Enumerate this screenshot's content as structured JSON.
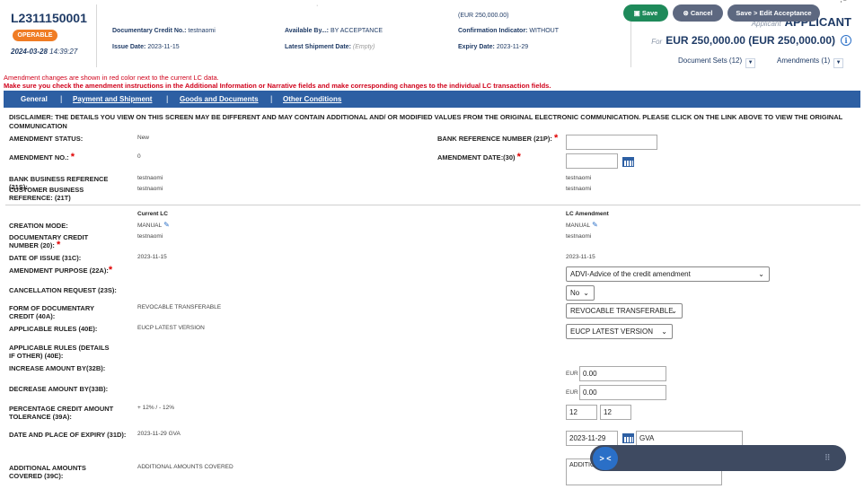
{
  "header": {
    "lc_ref": "L2311150001",
    "status_badge": "OPERABLE",
    "date": "2024-03-28",
    "time": "14:39:27",
    "documentary_credit_no_label": "Documentary Credit No.:",
    "documentary_credit_no": "testnaomi",
    "issue_date_label": "Issue Date:",
    "issue_date": "2023-11-15",
    "available_by_label": "Available By...:",
    "available_by": "BY ACCEPTANCE",
    "latest_shipment_label": "Latest Shipment Date:",
    "latest_shipment": "(Empty)",
    "amount_small": "(EUR 250,000.00)",
    "confirmation_label": "Confirmation Indicator:",
    "confirmation": "WITHOUT",
    "expiry_label": "Expiry Date:",
    "expiry": "2023-11-29",
    "applicant_label": "Applicant",
    "applicant": "APPLICANT",
    "for_label": "For",
    "amount": "EUR 250,000.00 (EUR 250,000.00)",
    "document_sets": "Document Sets (12)",
    "amendments": "Amendments (1)",
    "dot": "·",
    "corner_glyphs": "′ ‾"
  },
  "warnings": {
    "line1": "Amendment changes are shown in red color next to the current LC data.",
    "line2": "Make sure you check the amendment instructions in the Additional Information or Narrative fields and make corresponding changes to the individual LC transaction fields."
  },
  "tabs": [
    "General",
    "Payment and Shipment",
    "Goods and Documents",
    "Other Conditions"
  ],
  "tab_separator": "|",
  "form": {
    "disclaimer": "DISCLAIMER: THE DETAILS YOU VIEW ON THIS SCREEN MAY BE DIFFERENT AND MAY CONTAIN ADDITIONAL AND/ OR MODIFIED VALUES FROM THE ORIGINAL ELECTRONIC COMMUNICATION. PLEASE CLICK ON THE LINK ABOVE TO VIEW THE ORIGINAL COMMUNICATION",
    "amendment_status_label": "AMENDMENT STATUS:",
    "amendment_status": "New",
    "bank_ref_label": "BANK REFERENCE NUMBER (21P):",
    "amendment_no_label": "AMENDMENT NO.:",
    "amendment_no": "0",
    "amendment_date_label": "AMENDMENT DATE:(30)",
    "bank_business_ref_label": "BANK BUSINESS REFERENCE (21S):",
    "bank_business_ref": "testnaomi",
    "bank_business_ref_amend": "testnaomi",
    "customer_business_ref_label": "CUSTOMER BUSINESS REFERENCE: (21T)",
    "customer_business_ref": "testnaomi",
    "customer_business_ref_amend": "testnaomi",
    "current_lc_header": "Current LC",
    "lc_amendment_header": "LC Amendment",
    "creation_mode_label": "CREATION MODE:",
    "creation_mode": "MANUAL",
    "creation_mode_amend": "MANUAL",
    "doc_credit_no_label": "DOCUMENTARY CREDIT NUMBER (20):",
    "doc_credit_no": "testnaomi",
    "doc_credit_no_amend": "testnaomi",
    "date_of_issue_label": "DATE OF ISSUE (31C):",
    "date_of_issue": "2023-11-15",
    "date_of_issue_amend": "2023-11-15",
    "amendment_purpose_label": "AMENDMENT PURPOSE (22A):",
    "amendment_purpose": "ADVI-Advice of the credit amendment",
    "cancellation_label": "CANCELLATION REQUEST (23S):",
    "cancellation": "No",
    "form_of_credit_label": "FORM OF DOCUMENTARY CREDIT (40A):",
    "form_of_credit": "REVOCABLE TRANSFERABLE",
    "form_of_credit_amend": "REVOCABLE TRANSFERABLE",
    "applicable_rules_label": "APPLICABLE RULES (40E):",
    "applicable_rules": "EUCP LATEST VERSION",
    "applicable_rules_amend": "EUCP LATEST VERSION",
    "applicable_rules_other_label": "APPLICABLE RULES (DETAILS IF OTHER) (40E):",
    "increase_label": "INCREASE AMOUNT BY(32B):",
    "increase_currency": "EUR",
    "increase": "0.00",
    "decrease_label": "DECREASE AMOUNT BY(33B):",
    "decrease_currency": "EUR",
    "decrease": "0.00",
    "tolerance_label": "PERCENTAGE CREDIT AMOUNT TOLERANCE (39A):",
    "tolerance": "+ 12% / - 12%",
    "tolerance_plus": "12",
    "tolerance_minus": "12",
    "expiry_place_label": "DATE AND PLACE OF EXPIRY (31D):",
    "expiry_place": "2023-11-29 GVA",
    "expiry_date_amend": "2023-11-29",
    "expiry_place_amend": "GVA",
    "additional_amounts_label": "ADDITIONAL AMOUNTS COVERED (39C):",
    "additional_amounts": "ADDITIONAL AMOUNTS COVERED",
    "additional_amounts_amend": "ADDITIO"
  },
  "actions": {
    "nav": "> <",
    "save": "Save",
    "cancel": "Cancel",
    "save_edit": "Save > Edit Acceptance",
    "grip": "⠿"
  },
  "colors": {
    "brand": "#1f3b66",
    "tab_bar": "#2d5fa3",
    "badge": "#f07c24",
    "warning": "#d0021b",
    "save": "#1e8a5a",
    "action_bar": "#3e4a61"
  }
}
